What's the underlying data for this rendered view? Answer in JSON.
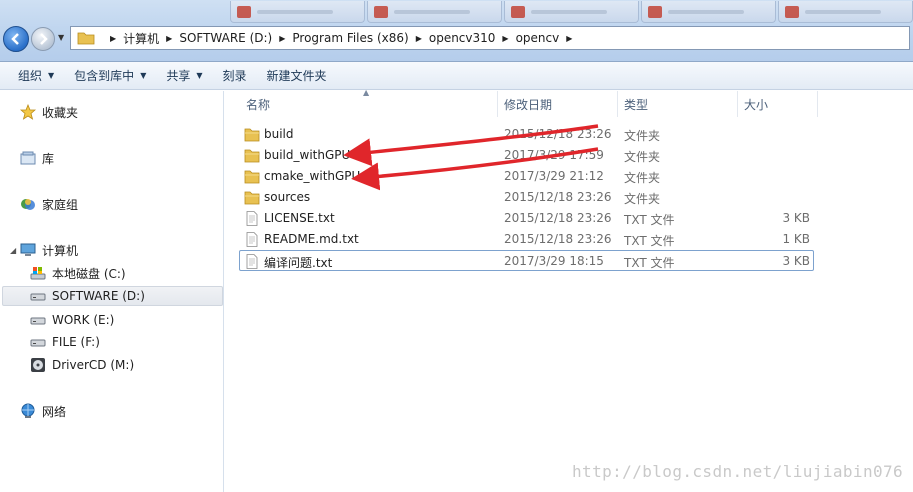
{
  "address": {
    "crumbs": [
      "计算机",
      "SOFTWARE (D:)",
      "Program Files (x86)",
      "opencv310",
      "opencv"
    ]
  },
  "toolbar": {
    "organize": "组织",
    "include_library": "包含到库中",
    "share": "共享",
    "burn": "刻录",
    "new_folder": "新建文件夹"
  },
  "nav": {
    "favorites": "收藏夹",
    "libraries": "库",
    "homegroup": "家庭组",
    "computer": "计算机",
    "drives": [
      {
        "label": "本地磁盘 (C:)"
      },
      {
        "label": "SOFTWARE (D:)"
      },
      {
        "label": "WORK (E:)"
      },
      {
        "label": "FILE (F:)"
      },
      {
        "label": "DriverCD (M:)"
      }
    ],
    "network": "网络"
  },
  "columns": {
    "name": "名称",
    "date": "修改日期",
    "type": "类型",
    "size": "大小"
  },
  "files": [
    {
      "name": "build",
      "date": "2015/12/18 23:26",
      "type": "文件夹",
      "size": "",
      "kind": "folder"
    },
    {
      "name": "build_withGPU",
      "date": "2017/3/29 17:59",
      "type": "文件夹",
      "size": "",
      "kind": "folder"
    },
    {
      "name": "cmake_withGPU",
      "date": "2017/3/29 21:12",
      "type": "文件夹",
      "size": "",
      "kind": "folder"
    },
    {
      "name": "sources",
      "date": "2015/12/18 23:26",
      "type": "文件夹",
      "size": "",
      "kind": "folder"
    },
    {
      "name": "LICENSE.txt",
      "date": "2015/12/18 23:26",
      "type": "TXT 文件",
      "size": "3 KB",
      "kind": "txt"
    },
    {
      "name": "README.md.txt",
      "date": "2015/12/18 23:26",
      "type": "TXT 文件",
      "size": "1 KB",
      "kind": "txt"
    },
    {
      "name": "编译问题.txt",
      "date": "2017/3/29 18:15",
      "type": "TXT 文件",
      "size": "3 KB",
      "kind": "txt"
    }
  ],
  "watermark": "http://blog.csdn.net/liujiabin076",
  "colors": {
    "annotation_arrow": "#e0262b",
    "folder": "#e8c152",
    "selection_border": "#7da2ce"
  }
}
